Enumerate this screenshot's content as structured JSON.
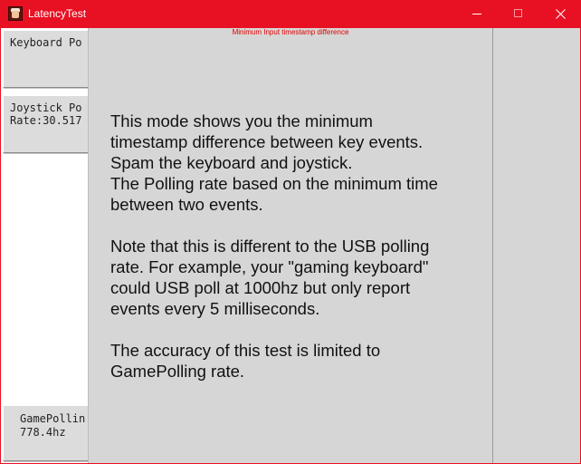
{
  "window": {
    "title": "LatencyTest",
    "icon": "app-icon",
    "accent_color": "#e81123",
    "controls": {
      "minimize": "minimize-icon",
      "maximize": "maximize-icon",
      "close": "close-icon"
    }
  },
  "sidebar": {
    "keyboard": {
      "line1": "Keyboard Po",
      "line2": ""
    },
    "joystick": {
      "line1": "Joystick Po",
      "line2": "Rate:30.517"
    },
    "gamepolling": {
      "line1": "GamePollin",
      "line2": "778.4hz"
    }
  },
  "main": {
    "title": "Minimum Input timestamp difference",
    "title_color": "#e00000",
    "description": "This mode shows you the minimum\ntimestamp difference between key events.\nSpam the keyboard and joystick.\nThe Polling rate based on the minimum time\nbetween two events.\n\nNote that this is different to the USB polling\nrate. For example, your \"gaming keyboard\"\ncould USB poll at 1000hz but only report\nevents every 5 milliseconds.\n\nThe accuracy of this test is limited to\nGamePolling rate."
  }
}
